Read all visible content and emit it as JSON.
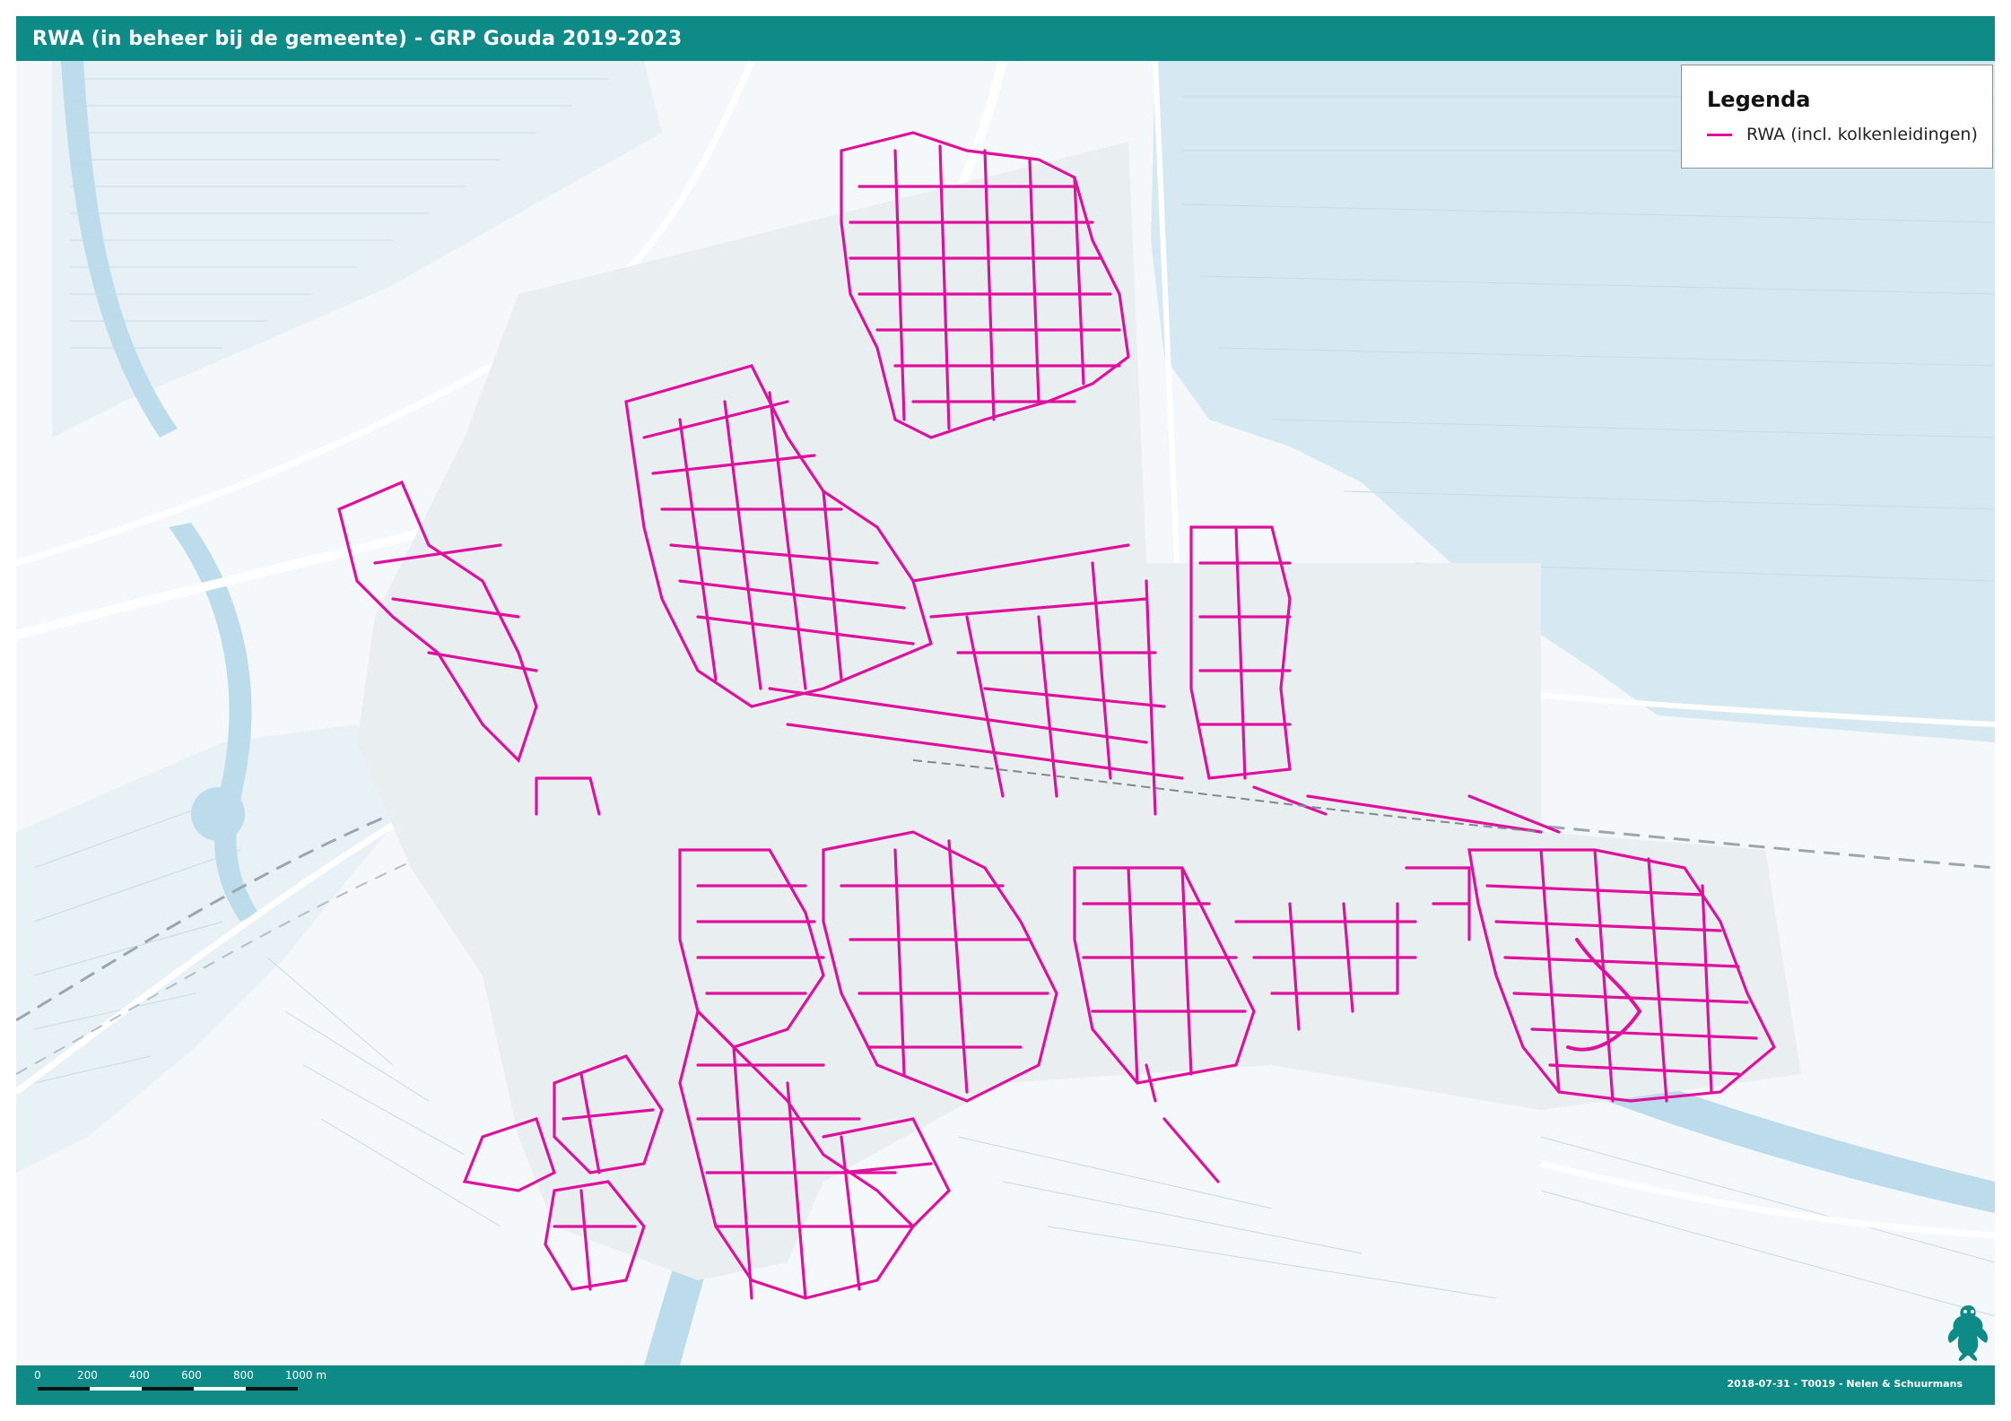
{
  "title": "RWA (in beheer bij de gemeente) - GRP Gouda 2019-2023",
  "legend": {
    "title": "Legenda",
    "items": [
      {
        "label": "RWA (incl. kolkenleidingen)",
        "color": "#e0109e"
      }
    ]
  },
  "scalebar": {
    "labels": [
      "0",
      "200",
      "400",
      "600",
      "800",
      "1000 m"
    ]
  },
  "footer": {
    "credit": "2018-07-31 - T0019 - Nelen & Schuurmans"
  },
  "colors": {
    "header": "#0e8a87",
    "network": "#e0109e",
    "water": "#cfe6f1",
    "land": "#f4f8fa",
    "road": "#ffffff"
  },
  "icons": {
    "logo": "frog-icon"
  }
}
